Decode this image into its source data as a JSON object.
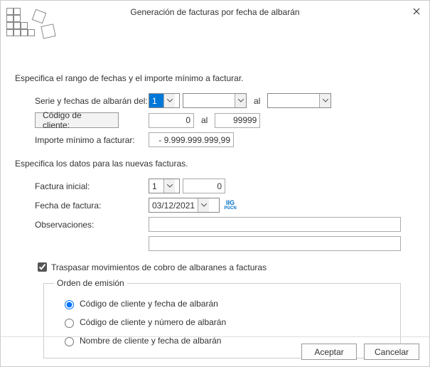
{
  "window": {
    "title": "Generación de facturas por fecha de albarán"
  },
  "section1": {
    "header": "Especifica el rango de fechas y el importe mínimo a facturar.",
    "serieLbl": "Serie y fechas de albarán del:",
    "serieVal": "1",
    "al": "al",
    "codClienteBtn": "Código de cliente:",
    "codClienteFrom": "0",
    "codClienteTo": "99999",
    "importeLbl": "Importe mínimo a facturar:",
    "importeVal": "-  9.999.999.999,99"
  },
  "section2": {
    "header": "Especifica los datos para las nuevas facturas.",
    "facturaInicialLbl": "Factura inicial:",
    "facturaSerie": "1",
    "facturaNum": "0",
    "fechaLbl": "Fecha de factura:",
    "fechaVal": "03/12/2021",
    "obsLbl": "Observaciones:",
    "obs1": "",
    "obs2": ""
  },
  "traspasar": {
    "label": "Traspasar movimientos de cobro de albaranes a facturas",
    "checked": true
  },
  "orden": {
    "legend": "Orden de emisión",
    "opt1": "Código de cliente y fecha de albarán",
    "opt2": "Código de cliente y número de albarán",
    "opt3": "Nombre de cliente y fecha de albarán"
  },
  "footer": {
    "accept": "Aceptar",
    "cancel": "Cancelar"
  }
}
